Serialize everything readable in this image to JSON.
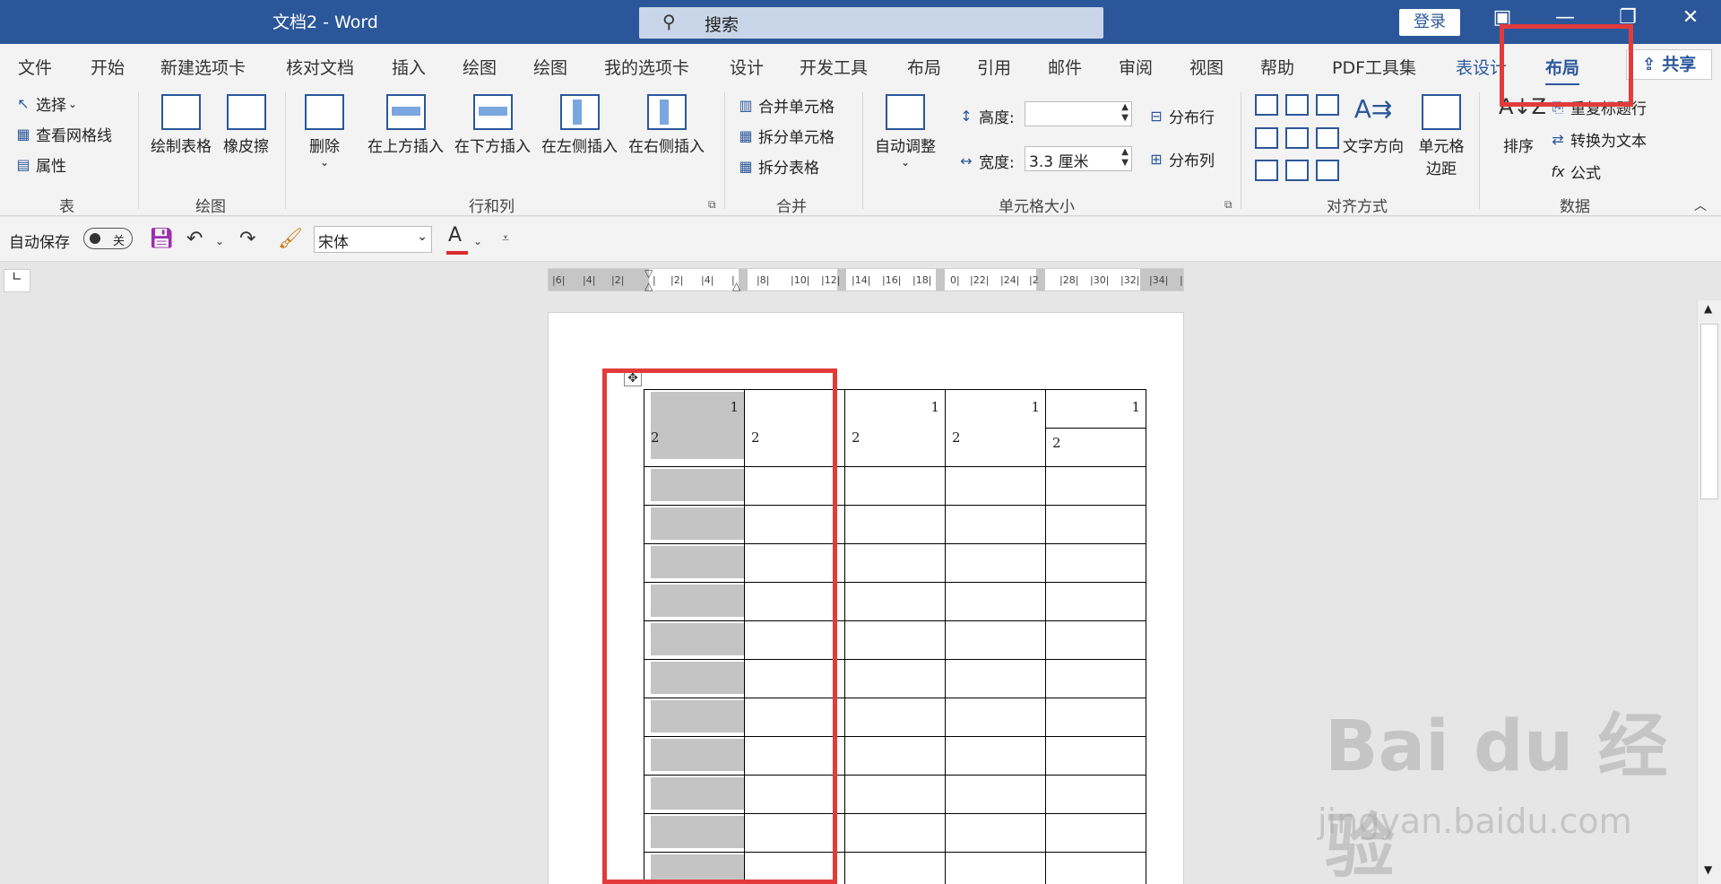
{
  "titlebar": {
    "title": "文档2  -  Word",
    "search_placeholder": "搜索",
    "login": "登录",
    "bg_color": "#2b579a"
  },
  "tabs": {
    "file": "文件",
    "home": "开始",
    "new_tab": "新建选项卡",
    "proof": "核对文档",
    "insert": "插入",
    "draw1": "绘图",
    "draw2": "绘图",
    "my_tab": "我的选项卡",
    "design": "设计",
    "developer": "开发工具",
    "layout": "布局",
    "references": "引用",
    "mailings": "邮件",
    "review": "审阅",
    "view": "视图",
    "help": "帮助",
    "pdf": "PDF工具集",
    "table_design": "表设计",
    "table_layout": "布局",
    "share": "共享"
  },
  "ribbon": {
    "table": {
      "select": "选择",
      "gridlines": "查看网格线",
      "properties": "属性",
      "label": "表"
    },
    "draw": {
      "draw_table": "绘制表格",
      "eraser": "橡皮擦",
      "label": "绘图"
    },
    "rows_cols": {
      "delete": "删除",
      "insert_above": "在上方插入",
      "insert_below": "在下方插入",
      "insert_left": "在左侧插入",
      "insert_right": "在右侧插入",
      "label": "行和列"
    },
    "merge": {
      "merge_cells": "合并单元格",
      "split_cells": "拆分单元格",
      "split_table": "拆分表格",
      "label": "合并"
    },
    "cell_size": {
      "autofit": "自动调整",
      "height_label": "高度:",
      "height_value": "",
      "width_label": "宽度:",
      "width_value": "3.3 厘米",
      "distribute_rows": "分布行",
      "distribute_cols": "分布列",
      "label": "单元格大小"
    },
    "alignment": {
      "text_direction": "文字方向",
      "cell_margins": "单元格边距",
      "label": "对齐方式"
    },
    "data": {
      "sort": "排序",
      "repeat_header": "重复标题行",
      "convert_text": "转换为文本",
      "formula": "公式",
      "label": "数据"
    }
  },
  "qat": {
    "autosave_label": "自动保存",
    "autosave_state": "关",
    "font_name": "宋体",
    "font_color": "#d92c2c"
  },
  "ruler": {
    "ticks": [
      "|6|",
      "|4|",
      "|2|",
      "|",
      "|2|",
      "|4|",
      "|",
      "|8|",
      "|10|",
      "|12|",
      "|14|",
      "|16|",
      "|18|",
      "0|",
      "|22|",
      "|24|",
      "|2",
      "|28|",
      "|30|",
      "|32|",
      "|34|",
      "|"
    ]
  },
  "document": {
    "header_cells": [
      {
        "top": "1",
        "bottom": "2"
      },
      {
        "top": "",
        "bottom": "2"
      },
      {
        "top": "1",
        "bottom": "2"
      },
      {
        "top": "1",
        "bottom": "2"
      },
      {
        "top": "1",
        "bottom": "2"
      }
    ],
    "body_rows": 11,
    "columns": 5
  },
  "watermark": {
    "logo": "Bai du 经验",
    "url": "jingyan.baidu.com"
  },
  "colors": {
    "accent": "#2b579a",
    "annotation": "#e23b3b",
    "selection": "#c4c4c4"
  }
}
